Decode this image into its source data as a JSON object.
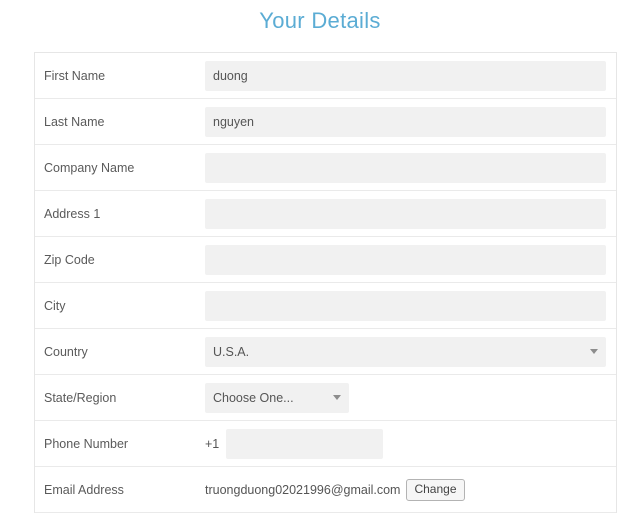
{
  "page": {
    "title": "Your Details"
  },
  "form": {
    "rows": [
      {
        "label": "First Name",
        "type": "text",
        "value": "duong",
        "placeholder": ""
      },
      {
        "label": "Last Name",
        "type": "text",
        "value": "nguyen",
        "placeholder": ""
      },
      {
        "label": "Company Name",
        "type": "text",
        "value": "",
        "placeholder": ""
      },
      {
        "label": "Address 1",
        "type": "text",
        "value": "",
        "placeholder": ""
      },
      {
        "label": "Zip Code",
        "type": "text",
        "value": "",
        "placeholder": ""
      },
      {
        "label": "City",
        "type": "text",
        "value": "",
        "placeholder": ""
      },
      {
        "label": "Country",
        "type": "select",
        "value": "U.S.A."
      },
      {
        "label": "State/Region",
        "type": "select",
        "value": "Choose One..."
      },
      {
        "label": "Phone Number",
        "type": "phone",
        "prefix": "+1",
        "value": "",
        "placeholder": ""
      },
      {
        "label": "Email Address",
        "type": "email",
        "value": "truongduong02021996@gmail.com",
        "action_label": "Change"
      }
    ]
  },
  "icons": {
    "caret": "chevron-down-icon"
  },
  "colors": {
    "title": "#5bacd4",
    "field_background": "#f1f1f1",
    "border": "#eaeaea",
    "label_text": "#5a5a5a"
  }
}
